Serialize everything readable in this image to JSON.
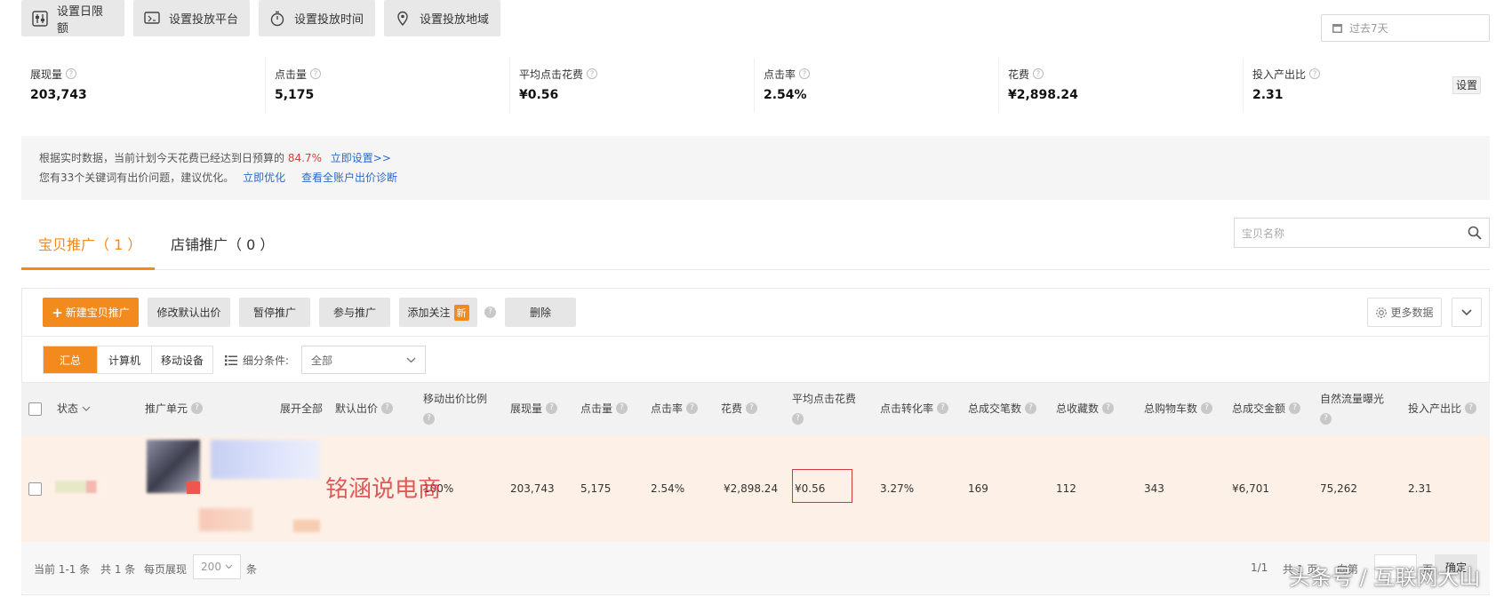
{
  "toolbar": {
    "daily_limit": "设置日限额",
    "platform": "设置投放平台",
    "time": "设置投放时间",
    "region": "设置投放地域"
  },
  "date_range": "过去7天",
  "metrics": [
    {
      "label": "展现量",
      "value": "203,743"
    },
    {
      "label": "点击量",
      "value": "5,175"
    },
    {
      "label": "平均点击花费",
      "value": "¥0.56"
    },
    {
      "label": "点击率",
      "value": "2.54%"
    },
    {
      "label": "花费",
      "value": "¥2,898.24"
    },
    {
      "label": "投入产出比",
      "value": "2.31"
    }
  ],
  "settings_label": "设置",
  "notice": {
    "line1_text": "根据实时数据，当前计划今天花费已经达到日预算的",
    "line1_percent": "84.7%",
    "line1_link": "立即设置>>",
    "line2_text": "您有33个关键词有出价问题，建议优化。",
    "line2_link1": "立即优化",
    "line2_link2": "查看全账户出价诊断"
  },
  "tabs": [
    {
      "label": "宝贝推广（ 1 ）",
      "active": true
    },
    {
      "label": "店铺推广（ 0 ）",
      "active": false
    }
  ],
  "search_placeholder": "宝贝名称",
  "actions": {
    "new": "新建宝贝推广",
    "modify_bid": "修改默认出价",
    "pause": "暂停推广",
    "join": "参与推广",
    "follow": "添加关注",
    "new_badge": "新",
    "delete": "删除",
    "more_data": "更多数据"
  },
  "segments": [
    "汇总",
    "计算机",
    "移动设备"
  ],
  "filter_label": "细分条件:",
  "filter_value": "全部",
  "columns": {
    "status": "状态",
    "unit": "推广单元",
    "expand_all": "展开全部",
    "default_bid": "默认出价",
    "mobile_ratio": "移动出价比例",
    "impressions": "展现量",
    "clicks": "点击量",
    "ctr": "点击率",
    "cost": "花费",
    "avg_cpc": "平均点击花费",
    "cvr": "点击转化率",
    "orders": "总成交笔数",
    "favorites": "总收藏数",
    "cart": "总购物车数",
    "gmv": "总成交金额",
    "natural_exposure": "自然流量曝光",
    "roi": "投入产出比"
  },
  "row": {
    "mobile_ratio": "100%",
    "impressions": "203,743",
    "clicks": "5,175",
    "ctr": "2.54%",
    "cost": "¥2,898.24",
    "avg_cpc": "¥0.56",
    "cvr": "3.27%",
    "orders": "169",
    "favorites": "112",
    "cart": "343",
    "gmv": "¥6,701",
    "natural_exposure": "75,262",
    "roi": "2.31"
  },
  "footer": {
    "current": "当前 1-1 条",
    "total": "共 1 条",
    "per_page": "每页展现",
    "per_page_value": "200",
    "unit": "条",
    "pages": "1/1",
    "total_pages": "共 1 页",
    "goto": "向第",
    "page": "页",
    "confirm": "确定"
  },
  "watermark_text": "铭涵说电商",
  "watermark_credit": "头条号 / 互联网大山",
  "colors": {
    "accent": "#f28a1e",
    "link": "#2a6bc9",
    "warning": "#e4393c"
  }
}
